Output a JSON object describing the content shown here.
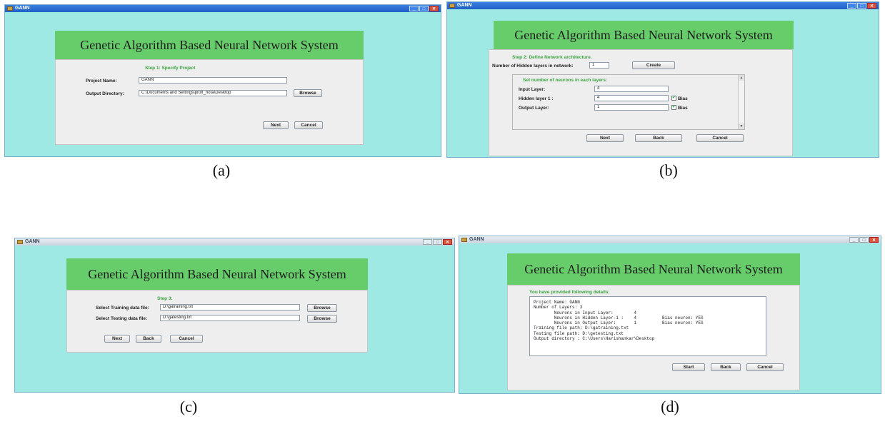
{
  "panels": {
    "a": {
      "window_title": "GANN",
      "banner": "Genetic Algorithm Based Neural Network System",
      "step": "Step 1: Specify Project",
      "project_name_label": "Project Name:",
      "project_name_value": "GANN",
      "output_dir_label": "Output Directory:",
      "output_dir_value": "C:\\Documents and Settings\\proff_hota\\Desktop",
      "browse": "Browse",
      "next": "Next",
      "cancel": "Cancel",
      "caption": "(a)"
    },
    "b": {
      "window_title": "GANN",
      "banner": "Genetic Algorithm Based Neural Network System",
      "step": "Step 2: Define Network architecture.",
      "hidden_layers_label": "Number of Hidden layers in network:",
      "hidden_layers_value": "1",
      "create": "Create",
      "neurons_heading": "Set number of neurons in each layers:",
      "layers": [
        {
          "label": "Input Layer:",
          "value": "4",
          "bias": ""
        },
        {
          "label": "Hidden layer 1 :",
          "value": "4",
          "bias": "Bias"
        },
        {
          "label": "Output Layer:",
          "value": "1",
          "bias": "Bias"
        }
      ],
      "next": "Next",
      "back": "Back",
      "cancel": "Cancel",
      "caption": "(b)"
    },
    "c": {
      "window_title": "GANN",
      "banner": "Genetic Algorithm Based Neural Network System",
      "step": "Step 3:",
      "training_label": "Select Training data file:",
      "training_value": "D:\\gatraining.txt",
      "testing_label": "Select Testing data file:",
      "testing_value": "D:\\gatesting.txt",
      "browse": "Browse",
      "next": "Next",
      "back": "Back",
      "cancel": "Cancel",
      "caption": "(c)"
    },
    "d": {
      "window_title": "GANN",
      "banner": "Genetic Algorithm Based Neural Network System",
      "step": "You have provided following details:",
      "details": [
        "Project Name: GANN",
        "Number of Layers: 3",
        "        Neurons in Input Layer:        4",
        "        Neurons in Hidden Layer-1 :    4          Bias neuron: YES",
        "        Neurons in Output Layer:       1          Bias neuron: YES",
        "Training file path: D:\\gatraining.txt",
        "Testing file path: D:\\getesting.txt",
        "Output directory : C:\\Users\\Harishankar\\Desktop"
      ],
      "start": "Start",
      "back": "Back",
      "cancel": "Cancel",
      "caption": "(d)"
    }
  },
  "colors": {
    "background": "#9ee9e3",
    "banner": "#67cc6a",
    "step_text": "#3aa33f"
  }
}
